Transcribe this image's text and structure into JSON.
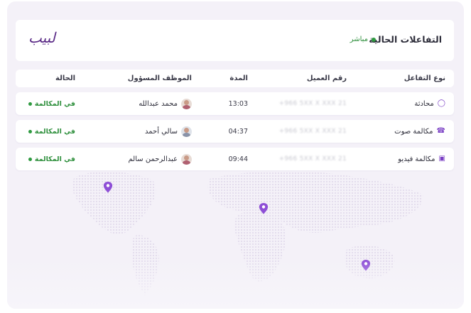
{
  "header": {
    "title": "التفاعلات الحالية",
    "live_label": "مباشر",
    "logo_text": "لبيب"
  },
  "table": {
    "columns": {
      "type": "نوع التفاعل",
      "customer_number": "رقم العميل",
      "duration": "المدة",
      "agent": "الموظف المسؤول",
      "status": "الحالة"
    },
    "rows": [
      {
        "type": "محادثة",
        "type_icon": "chat-icon",
        "customer_number": "+966 5XX X XXX 21",
        "duration": "13:03",
        "agent": "محمد عبدالله",
        "status": "في المكالمة"
      },
      {
        "type": "مكالمة صوت",
        "type_icon": "phone-icon",
        "customer_number": "+966 5XX X XXX 21",
        "duration": "04:37",
        "agent": "سالي أحمد",
        "status": "في المكالمة"
      },
      {
        "type": "مكالمة فيديو",
        "type_icon": "video-icon",
        "customer_number": "+966 5XX X XXX 21",
        "duration": "09:44",
        "agent": "عبدالرحمن سالم",
        "status": "في المكالمة"
      }
    ]
  },
  "map": {
    "pins": [
      "map-pin-icon",
      "map-pin-icon",
      "map-pin-icon"
    ]
  },
  "colors": {
    "accent": "#7a3fc4",
    "live_green": "#2e9a40",
    "logo": "#5a2a86",
    "background": "#f4f1f8"
  }
}
